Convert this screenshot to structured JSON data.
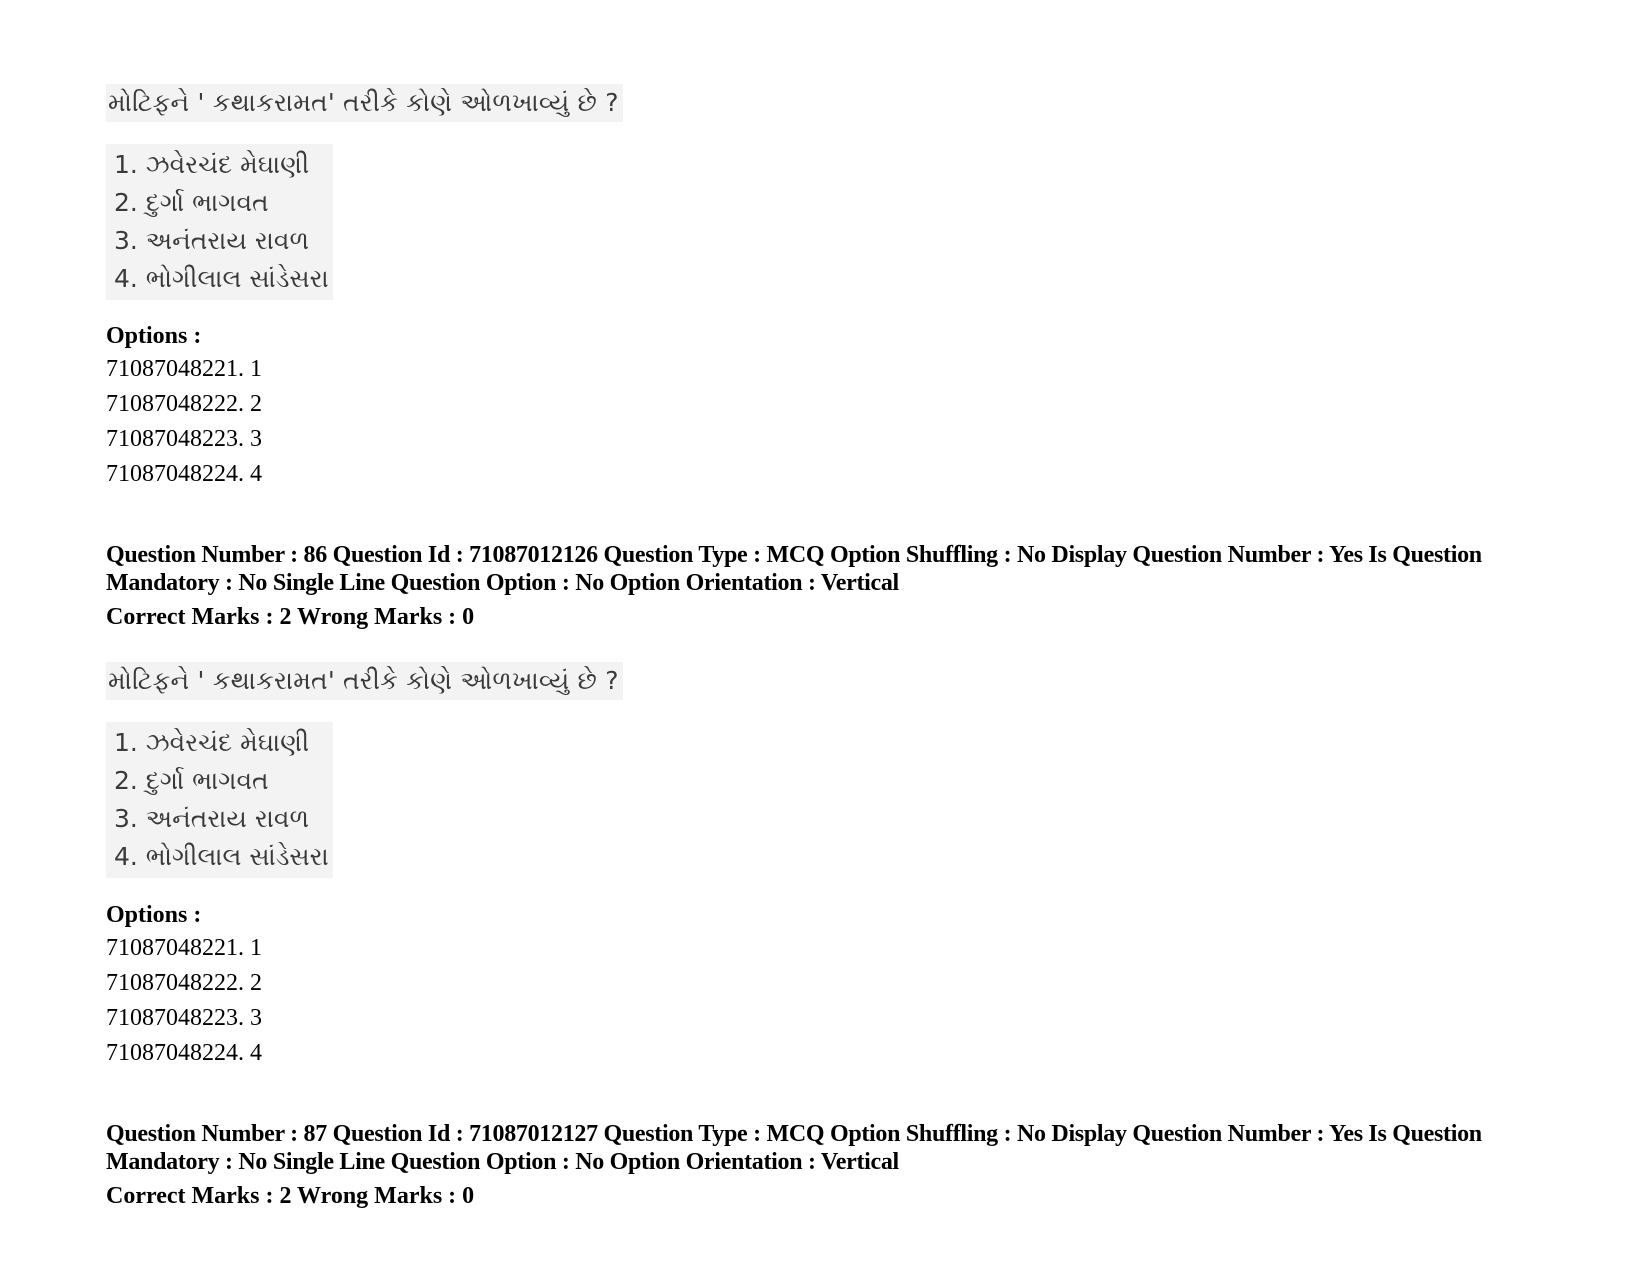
{
  "questions": [
    {
      "question_image": {
        "text": "મોટિફને ' કથાકરામત' તરીકે કોણે ઓળખાવ્યું છે ?",
        "items": [
          "1. ઝવેરચંદ મેઘાણી",
          "2. દુર્ગા ભાગવત",
          "3. અનંતરાય રાવળ",
          "4. ભોગીલાલ સાંડેસરા"
        ]
      },
      "options_label": "Options :",
      "options": [
        "71087048221. 1",
        "71087048222. 2",
        "71087048223. 3",
        "71087048224. 4"
      ]
    },
    {
      "meta_line": "Question Number : 86 Question Id : 71087012126 Question Type : MCQ Option Shuffling : No Display Question Number : Yes Is Question Mandatory : No Single Line Question Option : No Option Orientation : Vertical",
      "marks_line": "Correct Marks : 2 Wrong Marks : 0",
      "question_image": {
        "text": "મોટિફને ' કથાકરામત' તરીકે કોણે ઓળખાવ્યું છે ?",
        "items": [
          "1. ઝવેરચંદ મેઘાણી",
          "2. દુર્ગા ભાગવત",
          "3. અનંતરાય રાવળ",
          "4. ભોગીલાલ સાંડેસરા"
        ]
      },
      "options_label": "Options :",
      "options": [
        "71087048221. 1",
        "71087048222. 2",
        "71087048223. 3",
        "71087048224. 4"
      ]
    },
    {
      "meta_line": "Question Number : 87 Question Id : 71087012127 Question Type : MCQ Option Shuffling : No Display Question Number : Yes Is Question Mandatory : No Single Line Question Option : No Option Orientation : Vertical",
      "marks_line": "Correct Marks : 2 Wrong Marks : 0"
    }
  ]
}
